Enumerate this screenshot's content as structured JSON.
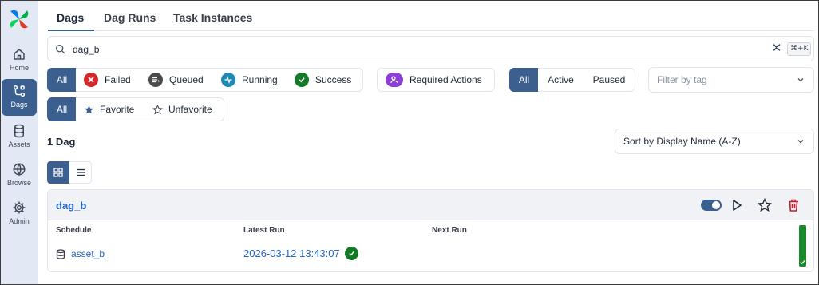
{
  "sidebar": {
    "items": [
      {
        "label": "Home",
        "icon": "home-icon"
      },
      {
        "label": "Dags",
        "icon": "dags-icon"
      },
      {
        "label": "Assets",
        "icon": "database-icon"
      },
      {
        "label": "Browse",
        "icon": "globe-icon"
      },
      {
        "label": "Admin",
        "icon": "gear-icon"
      }
    ],
    "active": "Dags"
  },
  "tabs": [
    "Dags",
    "Dag Runs",
    "Task Instances"
  ],
  "search": {
    "value": "dag_b",
    "shortcut": "⌘+K"
  },
  "state_filters": {
    "all": "All",
    "failed": "Failed",
    "queued": "Queued",
    "running": "Running",
    "success": "Success",
    "required_actions": "Required Actions"
  },
  "paused_filters": {
    "all": "All",
    "active": "Active",
    "paused": "Paused"
  },
  "tag_filter": {
    "placeholder": "Filter by tag"
  },
  "favorite_filters": {
    "all": "All",
    "favorite": "Favorite",
    "unfavorite": "Unfavorite"
  },
  "dag_count": "1 Dag",
  "sort": {
    "value": "Sort by Display Name (A-Z)"
  },
  "dag": {
    "name": "dag_b",
    "schedule_label": "Schedule",
    "latest_run_label": "Latest Run",
    "next_run_label": "Next Run",
    "schedule": "asset_b",
    "latest_run": "2026-03-12 13:43:07",
    "enabled": true,
    "latest_run_state": "success"
  },
  "colors": {
    "accent": "#3b5f8f",
    "failed": "#d62828",
    "queued": "#4b4b4b",
    "running": "#1e88b4",
    "success": "#137a28",
    "required_actions": "#8b3fd6",
    "link": "#2563c9",
    "delete": "#c0202a"
  }
}
